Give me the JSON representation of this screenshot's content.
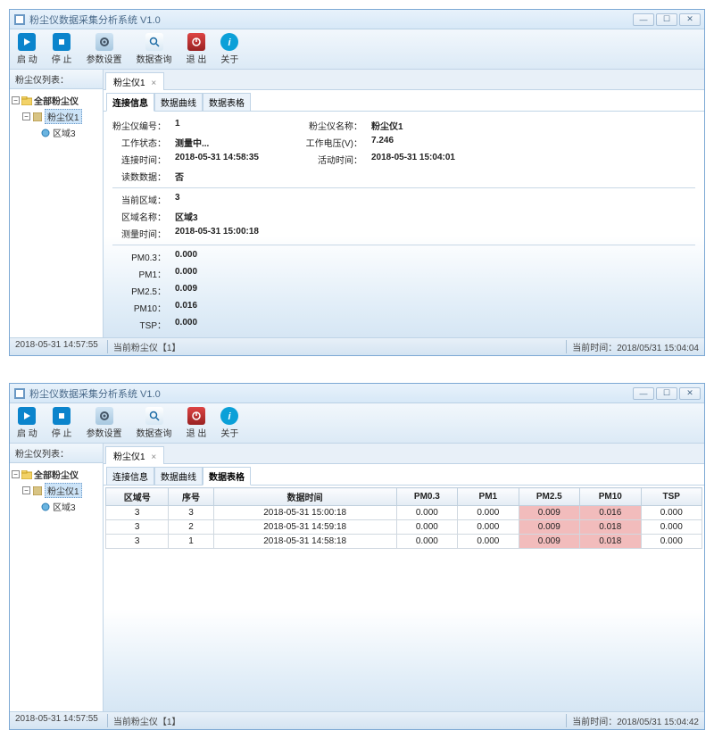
{
  "app_title": "粉尘仪数据采集分析系统 V1.0",
  "toolbar": {
    "start": "启 动",
    "stop": "停 止",
    "settings": "参数设置",
    "query": "数据查询",
    "exit": "退 出",
    "about": "关于"
  },
  "sidebar": {
    "header": "粉尘仪列表：",
    "root": "全部粉尘仪",
    "device": "粉尘仪1",
    "region": "区域3"
  },
  "device_tab": "粉尘仪1",
  "inner_tabs": {
    "info": "连接信息",
    "curve": "数据曲线",
    "table": "数据表格"
  },
  "win1": {
    "info": [
      {
        "l1": "粉尘仪编号：",
        "v1": "1",
        "l2": "粉尘仪名称：",
        "v2": "粉尘仪1"
      },
      {
        "l1": "工作状态：",
        "v1": "测量中...",
        "l2": "工作电压(V)：",
        "v2": "7.246"
      },
      {
        "l1": "连接时间：",
        "v1": "2018-05-31 14:58:35",
        "l2": "活动时间：",
        "v2": "2018-05-31 15:04:01"
      },
      {
        "l1": "读数数据：",
        "v1": "否"
      }
    ],
    "region_rows": [
      {
        "l": "当前区域：",
        "v": "3"
      },
      {
        "l": "区域名称：",
        "v": "区域3"
      },
      {
        "l": "测量时间：",
        "v": "2018-05-31 15:00:18"
      }
    ],
    "pm_rows": [
      {
        "l": "PM0.3：",
        "v": "0.000"
      },
      {
        "l": "PM1：",
        "v": "0.000"
      },
      {
        "l": "PM2.5：",
        "v": "0.009"
      },
      {
        "l": "PM10：",
        "v": "0.016"
      },
      {
        "l": "TSP：",
        "v": "0.000"
      }
    ],
    "status": {
      "time": "2018-05-31 14:57:55",
      "device": "当前粉尘仪【1】",
      "now": "当前时间：2018/05/31 15:04:04"
    }
  },
  "win2": {
    "table": {
      "headers": [
        "区域号",
        "序号",
        "数据时间",
        "PM0.3",
        "PM1",
        "PM2.5",
        "PM10",
        "TSP"
      ],
      "rows": [
        {
          "cells": [
            "3",
            "3",
            "2018-05-31 15:00:18",
            "0.000",
            "0.000",
            "0.009",
            "0.016",
            "0.000"
          ],
          "hl": [
            5,
            6
          ]
        },
        {
          "cells": [
            "3",
            "2",
            "2018-05-31 14:59:18",
            "0.000",
            "0.000",
            "0.009",
            "0.018",
            "0.000"
          ],
          "hl": [
            5,
            6
          ]
        },
        {
          "cells": [
            "3",
            "1",
            "2018-05-31 14:58:18",
            "0.000",
            "0.000",
            "0.009",
            "0.018",
            "0.000"
          ],
          "hl": [
            5,
            6
          ]
        }
      ]
    },
    "status": {
      "time": "2018-05-31 14:57:55",
      "device": "当前粉尘仪【1】",
      "now": "当前时间：2018/05/31 15:04:42"
    }
  }
}
